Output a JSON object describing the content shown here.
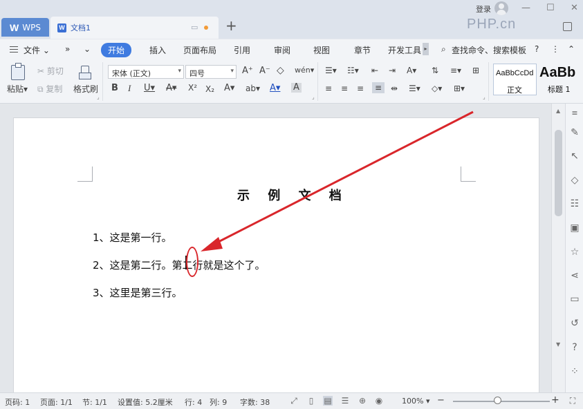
{
  "titlebar": {
    "wps_tab": "WPS",
    "doc_tab": "文档1",
    "login": "登录",
    "watermark": "PHP.cn"
  },
  "menu": {
    "file": "文件",
    "items": [
      "开始",
      "插入",
      "页面布局",
      "引用",
      "审阅",
      "视图",
      "章节",
      "开发工具"
    ],
    "search": "查找命令、搜索模板"
  },
  "toolbar": {
    "paste": "粘贴",
    "cut": "剪切",
    "copy": "复制",
    "format_painter": "格式刷",
    "font_name": "宋体 (正文)",
    "font_size": "四号",
    "bold": "B",
    "italic": "I",
    "underline": "U",
    "style_normal_preview": "AaBbCcDd",
    "style_normal": "正文",
    "style_heading_preview": "AaBb",
    "style_heading": "标题 1"
  },
  "document": {
    "title": "示 例 文 档",
    "lines": [
      "1、这是第一行。",
      "2、这是第二行。第二行就是这个了。",
      "3、这里是第三行。"
    ]
  },
  "status": {
    "page_no": "页码: 1",
    "pages": "页面: 1/1",
    "section": "节: 1/1",
    "setting": "设置值: 5.2厘米",
    "row": "行: 4",
    "col": "列: 9",
    "words": "字数: 38",
    "zoom": "100%",
    "zoom_level": 0.5
  },
  "colors": {
    "accent": "#3f7be0",
    "annotation": "#d9262b"
  }
}
